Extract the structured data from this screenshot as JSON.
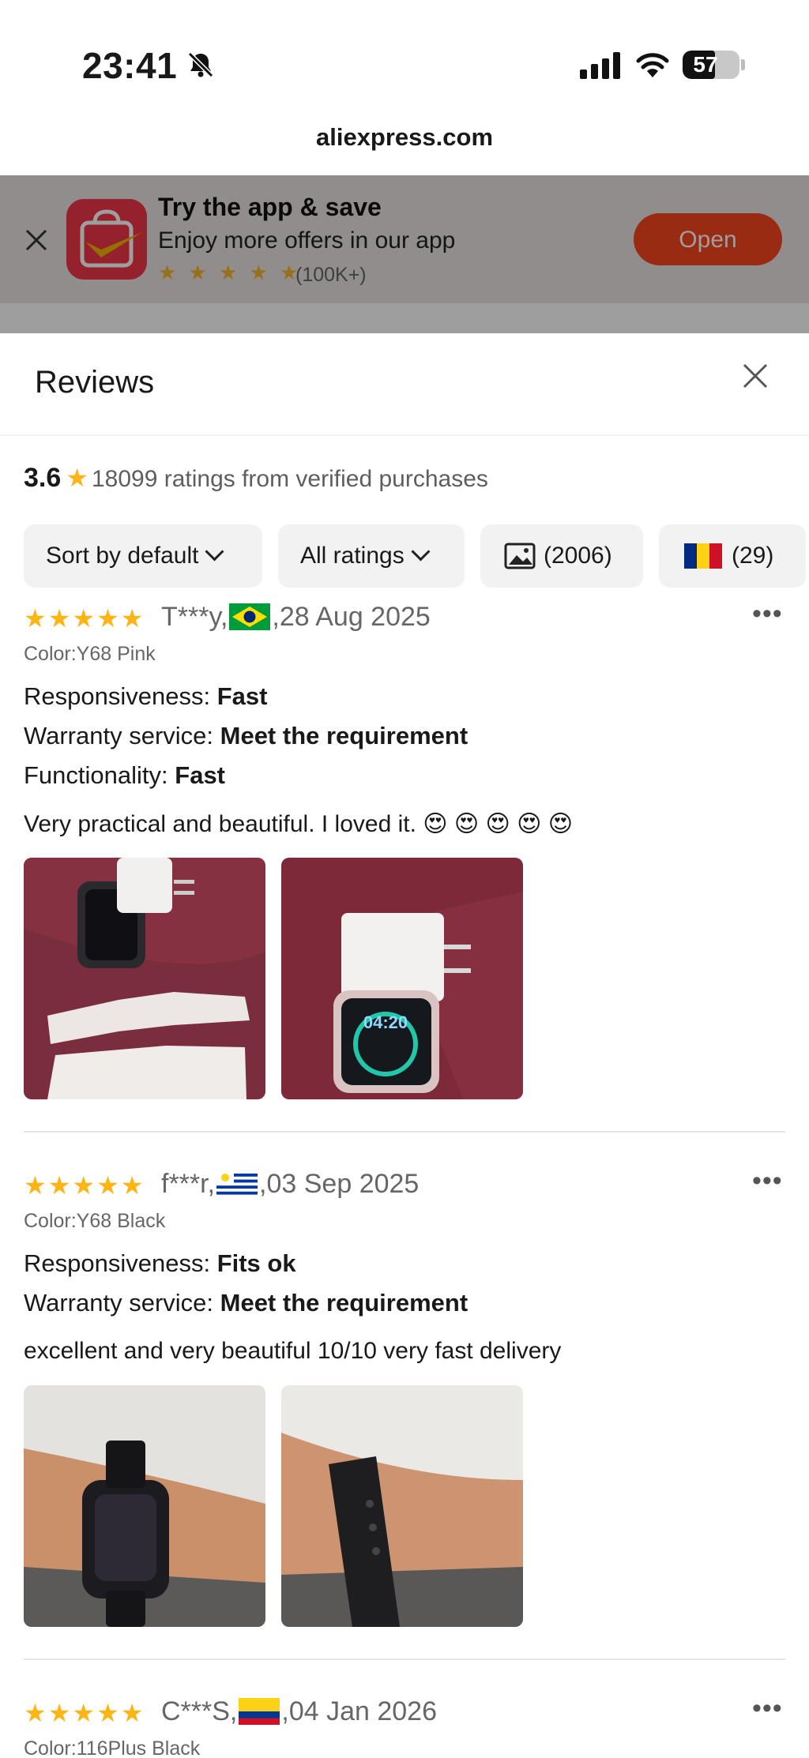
{
  "status_bar": {
    "time": "23:41",
    "battery": "57",
    "battery_level": 0.57
  },
  "browser": {
    "url": "aliexpress.com"
  },
  "app_banner": {
    "title": "Try the app & save",
    "subtitle": "Enjoy more offers in our app",
    "stars": "★ ★ ★ ★ ★",
    "rating_count": "(100K+)",
    "open_label": "Open"
  },
  "reviews_panel": {
    "title": "Reviews",
    "average": "3.6",
    "summary_text": "18099 ratings from verified purchases",
    "filters": {
      "sort": "Sort by default",
      "ratings": "All ratings",
      "photos_count": "(2006)",
      "country_count": "(29)"
    }
  },
  "reviews": [
    {
      "stars": "★★★★★",
      "reviewer": "T***y,",
      "date": ",28 Aug 2025",
      "color": "Color:Y68 Pink",
      "attributes": [
        {
          "label": "Responsiveness: ",
          "value": "Fast"
        },
        {
          "label": "Warranty service: ",
          "value": "Meet the requirement"
        },
        {
          "label": "Functionality: ",
          "value": "Fast"
        }
      ],
      "text": "Very practical and beautiful. I loved it. 😍 😍 😍 😍 😍"
    },
    {
      "stars": "★★★★★",
      "reviewer": "f***r,",
      "date": ",03 Sep 2025",
      "color": "Color:Y68 Black",
      "attributes": [
        {
          "label": "Responsiveness: ",
          "value": "Fits ok"
        },
        {
          "label": "Warranty service: ",
          "value": "Meet the requirement"
        }
      ],
      "text": "excellent and very beautiful 10/10 very fast delivery"
    },
    {
      "stars": "★★★★★",
      "reviewer": "C***S,",
      "date": ",04 Jan 2026",
      "color": "Color:116Plus Black"
    }
  ],
  "icons": {
    "bell": "bell-slash-icon",
    "signal": "cellular-signal-icon",
    "wifi": "wifi-icon",
    "close": "close-icon",
    "photo": "image-icon",
    "more": "more-options-icon"
  },
  "colors": {
    "accent": "#f7461d",
    "star": "#fdb515",
    "chip_bg": "#f2f2f2"
  }
}
